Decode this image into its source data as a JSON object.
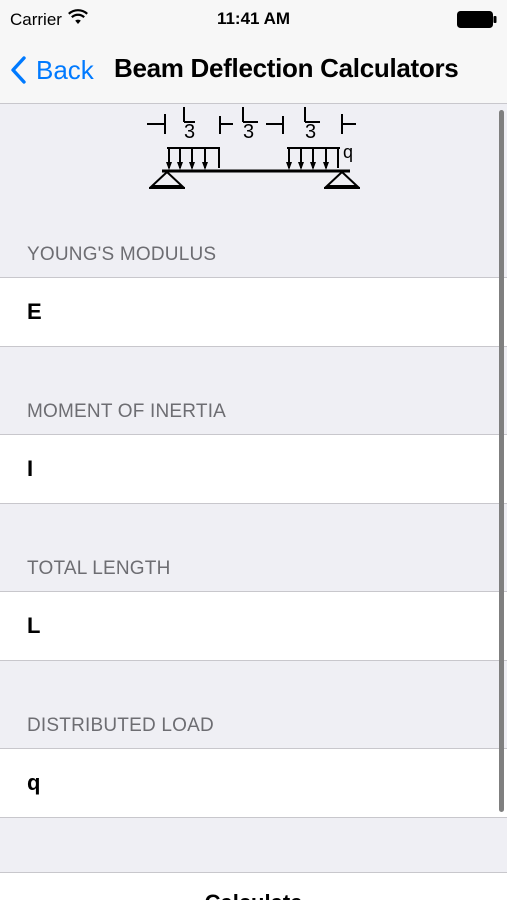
{
  "status_bar": {
    "carrier": "Carrier",
    "time": "11:41 AM"
  },
  "nav": {
    "back_label": "Back",
    "title": "Beam Deflection Calculators"
  },
  "diagram": {
    "dimension_labels": [
      "3",
      "3",
      "3"
    ],
    "load_label": "q"
  },
  "fields": [
    {
      "header": "YOUNG'S MODULUS",
      "placeholder": "E",
      "value": ""
    },
    {
      "header": "MOMENT OF INERTIA",
      "placeholder": "I",
      "value": ""
    },
    {
      "header": "TOTAL LENGTH",
      "placeholder": "L",
      "value": ""
    },
    {
      "header": "DISTRIBUTED LOAD",
      "placeholder": "q",
      "value": ""
    }
  ],
  "calculate_label": "Calculate"
}
